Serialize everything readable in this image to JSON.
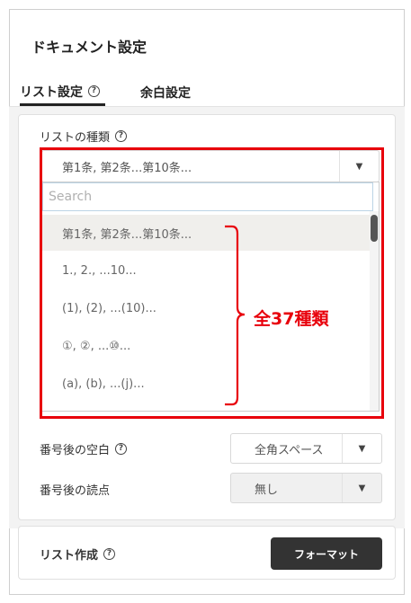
{
  "panel": {
    "title": "ドキュメント設定"
  },
  "tabs": [
    {
      "label": "リスト設定",
      "active": true
    },
    {
      "label": "余白設定",
      "active": false
    }
  ],
  "list_type": {
    "label": "リストの種類",
    "selected": "第1条, 第2条...第10条...",
    "search_placeholder": "Search",
    "options": [
      "第1条, 第2条...第10条...",
      "1., 2., ...10...",
      "(1), (2), ...(10)...",
      "①, ②, ...⑩...",
      "(a), (b), ...(j)..."
    ]
  },
  "annotation": {
    "count_label": "全37種類",
    "color": "#e8000b"
  },
  "after_number_space": {
    "label": "番号後の空白",
    "value": "全角スペース"
  },
  "after_number_punct": {
    "label": "番号後の読点",
    "value": "無し"
  },
  "list_create": {
    "label": "リスト作成",
    "button_label": "フォーマット"
  },
  "icons": {
    "help": "?",
    "arrow": "▼"
  }
}
